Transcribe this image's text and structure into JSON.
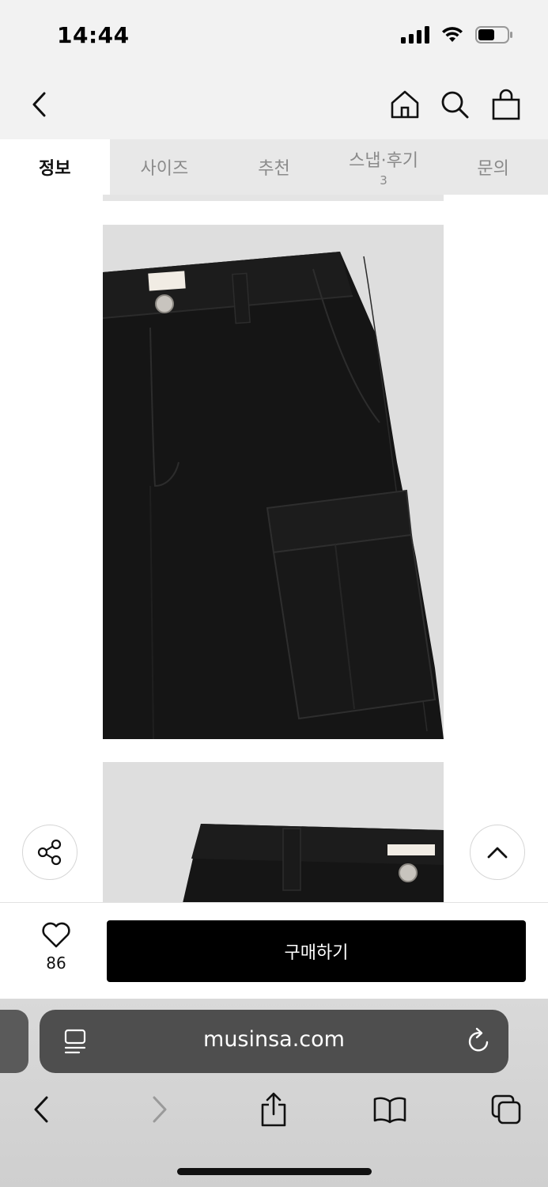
{
  "status_bar": {
    "time": "14:44",
    "icons": [
      "signal-icon",
      "wifi-icon",
      "battery-icon"
    ]
  },
  "header": {
    "icons": [
      "back-chevron-icon",
      "home-icon",
      "search-icon",
      "shopping-bag-icon"
    ]
  },
  "tabs": [
    {
      "label": "정보",
      "active": true
    },
    {
      "label": "사이즈",
      "active": false
    },
    {
      "label": "추천",
      "active": false
    },
    {
      "label": "스냅·후기",
      "count": "3",
      "active": false
    },
    {
      "label": "문의",
      "active": false
    }
  ],
  "content": {
    "images": [
      "black-cargo-pants-detail-photo",
      "black-cargo-pants-waist-photo"
    ],
    "floating": [
      "share-icon",
      "scroll-top-icon"
    ]
  },
  "purchase_bar": {
    "like_count": "86",
    "buy_label": "구매하기"
  },
  "browser": {
    "url": "musinsa.com",
    "icons": [
      "page-menu-icon",
      "reload-icon",
      "browser-back-icon",
      "browser-forward-icon",
      "share-sheet-icon",
      "bookmarks-icon",
      "tabs-icon"
    ]
  },
  "colors": {
    "header_bg": "#f2f2f2",
    "tab_inactive_bg": "#e8e8e8",
    "buy_button": "#000000",
    "url_pill": "#4e4e4e"
  }
}
